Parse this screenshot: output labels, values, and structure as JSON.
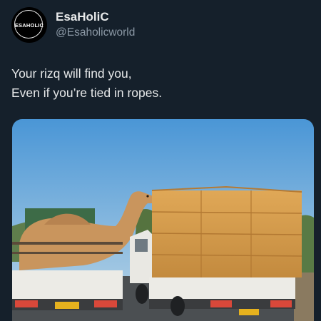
{
  "author": {
    "avatar_text": "ESAHOLIC",
    "display_name": "EsaHoliC",
    "handle": "@Esaholicworld"
  },
  "tweet": {
    "lines": [
      "Your rizq will find you,",
      "Even if you’re tied in ropes."
    ]
  },
  "media": {
    "icon": "photo",
    "colors": {
      "sky_top": "#4a96d6",
      "sky_bottom": "#b9d4e6",
      "hay": "#d49a4a",
      "camel": "#c9955d",
      "truck": "#ecebe6",
      "road": "#4b4f52"
    }
  },
  "colors": {
    "background": "#15202b",
    "primary_text": "#e7e9ea",
    "secondary_text": "#8b98a5"
  }
}
